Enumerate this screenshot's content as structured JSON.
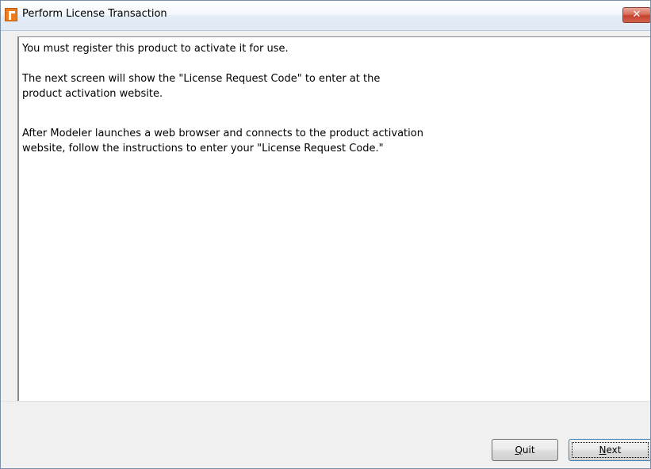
{
  "window": {
    "title": "Perform License Transaction",
    "close_glyph": "✕",
    "app_icon": "modeler-app-icon"
  },
  "message": {
    "line1": "You must register this product to activate it for use.",
    "line2": "The next screen will show the \"License Request Code\" to enter at the",
    "line3": "product activation website.",
    "line4": "After Modeler launches a web browser and connects to the product activation",
    "line5": "website, follow the instructions to enter your \"License Request Code.\""
  },
  "buttons": {
    "quit_first": "Q",
    "quit_rest": "uit",
    "next_first": "N",
    "next_rest": "ext"
  },
  "colors": {
    "accent": "#ee7d20",
    "close": "#c4432f"
  }
}
